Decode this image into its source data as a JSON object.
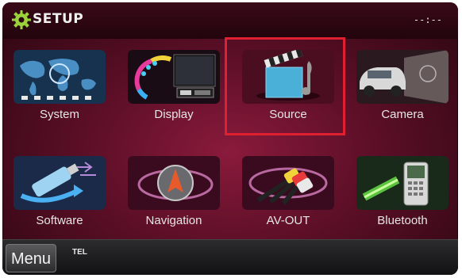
{
  "header": {
    "title": "SETUP",
    "clock": "--:--"
  },
  "tiles": [
    {
      "label": "System",
      "icon": "world-map-icon"
    },
    {
      "label": "Display",
      "icon": "display-icon"
    },
    {
      "label": "Source",
      "icon": "clapper-music-icon",
      "selected": true
    },
    {
      "label": "Camera",
      "icon": "car-camera-icon"
    },
    {
      "label": "Software",
      "icon": "usb-icon"
    },
    {
      "label": "Navigation",
      "icon": "compass-icon"
    },
    {
      "label": "AV-OUT",
      "icon": "av-cable-icon"
    },
    {
      "label": "Bluetooth",
      "icon": "bluetooth-phone-icon"
    }
  ],
  "footer": {
    "menu_label": "Menu",
    "tel_label": "TEL"
  },
  "colors": {
    "background": "#5c0f27",
    "highlight": "#e02030"
  }
}
